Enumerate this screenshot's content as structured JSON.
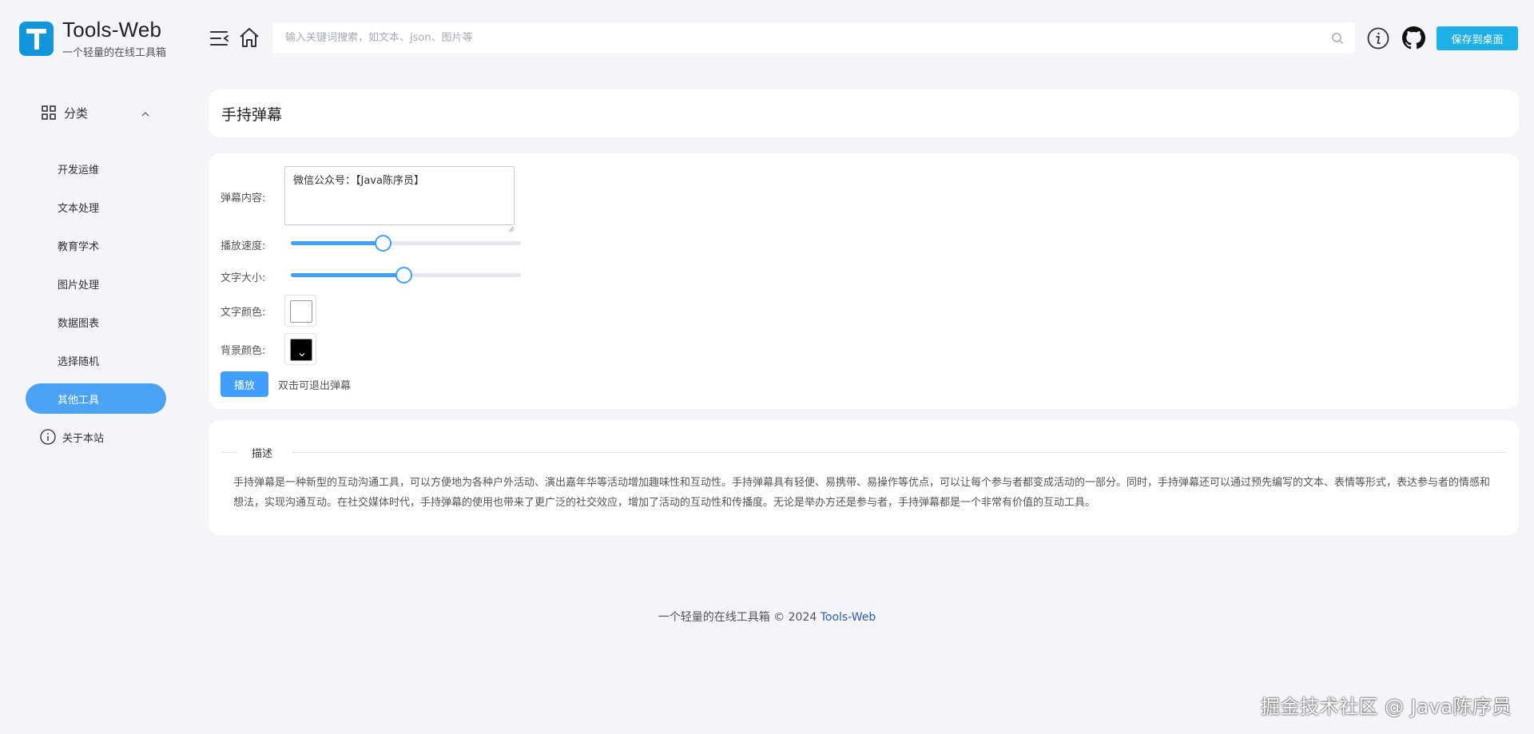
{
  "brand": {
    "title": "Tools-Web",
    "subtitle": "一个轻量的在线工具箱",
    "logo_color": "#1296db"
  },
  "header": {
    "search_placeholder": "输入关键词搜索，如文本、json、图片等",
    "save_label": "保存到桌面",
    "accent": "#1db0e7",
    "icons": [
      "menu-fold-icon",
      "home-icon",
      "search-icon",
      "info-icon",
      "github-icon"
    ]
  },
  "sidebar": {
    "category_label": "分类",
    "items": [
      {
        "label": "开发运维"
      },
      {
        "label": "文本处理"
      },
      {
        "label": "教育学术"
      },
      {
        "label": "图片处理"
      },
      {
        "label": "数据图表"
      },
      {
        "label": "选择随机"
      },
      {
        "label": "其他工具",
        "active": true
      }
    ],
    "about_label": "关于本站",
    "active_color": "#4aa3f5"
  },
  "page": {
    "title": "手持弹幕",
    "form": {
      "content_label": "弹幕内容:",
      "content_value": "微信公众号：【Java陈序员】",
      "speed_label": "播放速度:",
      "speed_fraction": 0.4,
      "size_label": "文字大小:",
      "size_fraction": 0.49,
      "text_color_label": "文字颜色:",
      "text_color": "#ffffff",
      "bg_color_label": "背景颜色:",
      "bg_color": "#000000",
      "play_label": "播放",
      "play_hint": "双击可退出弹幕"
    },
    "description": {
      "title": "描述",
      "text": "手持弹幕是一种新型的互动沟通工具，可以方便地为各种户外活动、演出嘉年华等活动增加趣味性和互动性。手持弹幕具有轻便、易携带、易操作等优点，可以让每个参与者都变成活动的一部分。同时，手持弹幕还可以通过预先编写的文本、表情等形式，表达参与者的情感和想法，实现沟通互动。在社交媒体时代，手持弹幕的使用也带来了更广泛的社交效应，增加了活动的互动性和传播度。无论是举办方还是参与者，手持弹幕都是一个非常有价值的互动工具。"
    }
  },
  "footer": {
    "text": "一个轻量的在线工具箱 © 2024",
    "link": "Tools-Web"
  },
  "watermark": "掘金技术社区 @ Java陈序员"
}
